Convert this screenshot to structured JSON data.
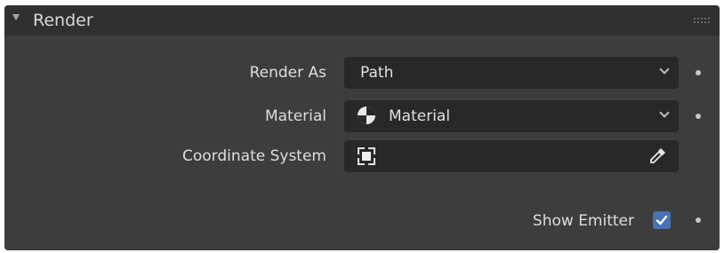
{
  "panel": {
    "title": "Render",
    "collapse_icon": "triangle-down-icon",
    "drag_icon": "drag-handle-icon"
  },
  "rows": {
    "render_as": {
      "label": "Render As",
      "value": "Path"
    },
    "material": {
      "label": "Material",
      "value": "Material",
      "icon": "material-sphere-icon"
    },
    "coordinate_system": {
      "label": "Coordinate System",
      "value": "",
      "icon": "object-icon",
      "picker_icon": "eyedropper-icon"
    },
    "show_emitter": {
      "label": "Show Emitter",
      "checked": true
    }
  },
  "colors": {
    "panel_bg": "#3d3d3d",
    "header_bg": "#303030",
    "field_bg": "#282828",
    "checkbox_accent": "#4772b3"
  }
}
